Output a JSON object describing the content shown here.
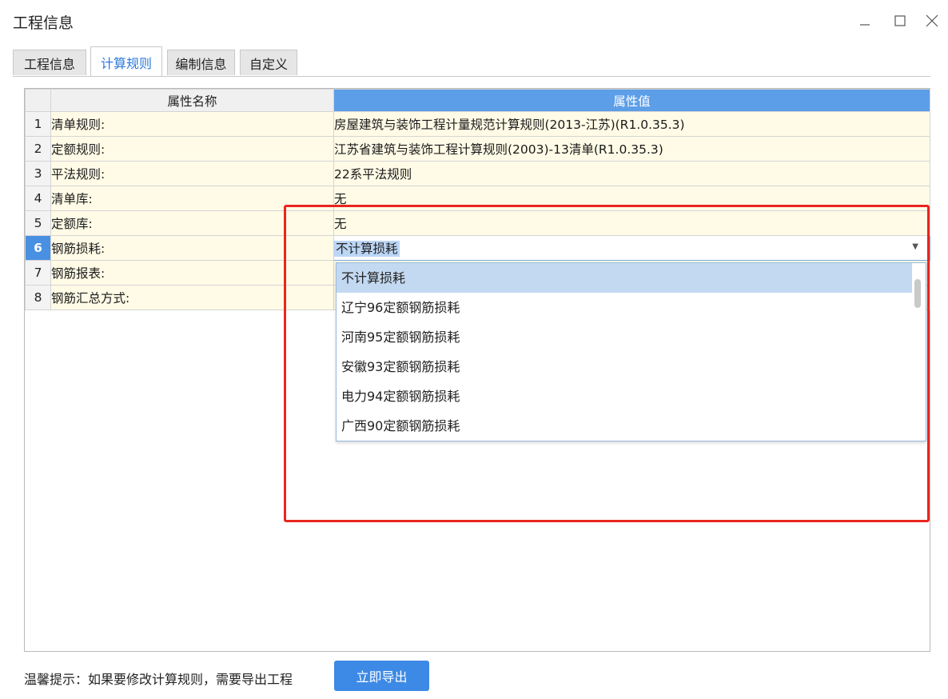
{
  "window": {
    "title": "工程信息",
    "controls": {
      "minimize": "minimize-icon",
      "maximize": "maximize-icon",
      "close": "close-icon"
    }
  },
  "tabs": [
    {
      "label": "工程信息",
      "active": false
    },
    {
      "label": "计算规则",
      "active": true
    },
    {
      "label": "编制信息",
      "active": false
    },
    {
      "label": "自定义",
      "active": false
    }
  ],
  "grid": {
    "columns": {
      "name": "属性名称",
      "value": "属性值"
    },
    "rows": [
      {
        "num": "1",
        "name": "清单规则:",
        "value": "房屋建筑与装饰工程计量规范计算规则(2013-江苏)(R1.0.35.3)"
      },
      {
        "num": "2",
        "name": "定额规则:",
        "value": "江苏省建筑与装饰工程计算规则(2003)-13清单(R1.0.35.3)"
      },
      {
        "num": "3",
        "name": "平法规则:",
        "value": "22系平法规则"
      },
      {
        "num": "4",
        "name": "清单库:",
        "value": "无"
      },
      {
        "num": "5",
        "name": "定额库:",
        "value": "无"
      },
      {
        "num": "6",
        "name": "钢筋损耗:",
        "value": "不计算损耗"
      },
      {
        "num": "7",
        "name": "钢筋报表:",
        "value": ""
      },
      {
        "num": "8",
        "name": "钢筋汇总方式:",
        "value": ""
      }
    ],
    "selected_row": "6"
  },
  "dropdown": {
    "current_value": "不计算损耗",
    "options": [
      "不计算损耗",
      "辽宁96定额钢筋损耗",
      "河南95定额钢筋损耗",
      "安徽93定额钢筋损耗",
      "电力94定额钢筋损耗",
      "广西90定额钢筋损耗"
    ],
    "selected_index": 0
  },
  "colors": {
    "accent": "#3c8ae6",
    "header_value_bg": "#5c9ee8",
    "row_bg": "#fffbe6",
    "highlight_box": "#e8261e"
  },
  "footer": {
    "hint": "温馨提示：如果要修改计算规则，需要导出工程",
    "export_button": "立即导出"
  }
}
